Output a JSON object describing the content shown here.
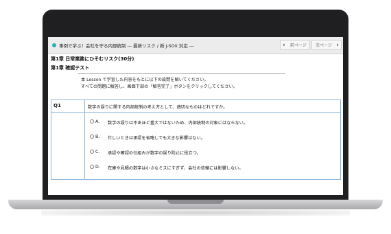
{
  "header": {
    "course_title": "事例で学ぶ！会社を守る内部統制 ― 最新リスク / 新 J-SOX 対応 ―",
    "prev_label": "前ページ",
    "next_label": "次ページ"
  },
  "content": {
    "chapter": "第1章 日常業務にひそむリスク(30分)",
    "subtitle": "第1章  確認テスト",
    "instructions": [
      "本 Lesson で学習した内容をもとに以下の設問を解いてください。",
      "すべての問題に解答し、画面下部の「解答完了」ボタンをクリックしてください。"
    ]
  },
  "question": {
    "number": "Q1",
    "text": "数字の誤りに関する内部統制の考え方として、適切なものはどれですか。",
    "options": [
      {
        "letter": "A.",
        "text": "数字の誤りは不正ほど重大ではないため、内部統制の対象にはならない。"
      },
      {
        "letter": "B.",
        "text": "忙しいときは承認を省略しても大きな影響はない。"
      },
      {
        "letter": "C.",
        "text": "承認や確認の仕組みが数字の誤り防止に役立つ。"
      },
      {
        "letter": "D.",
        "text": "在庫や見積の数字は小さなミスにすぎず、会社の信頼には影響しない。"
      }
    ]
  },
  "colors": {
    "accent": "#27b0b9",
    "table_border": "#8ab4d8"
  },
  "icons": {
    "prev": "chevron-left-icon",
    "next": "chevron-right-icon"
  }
}
